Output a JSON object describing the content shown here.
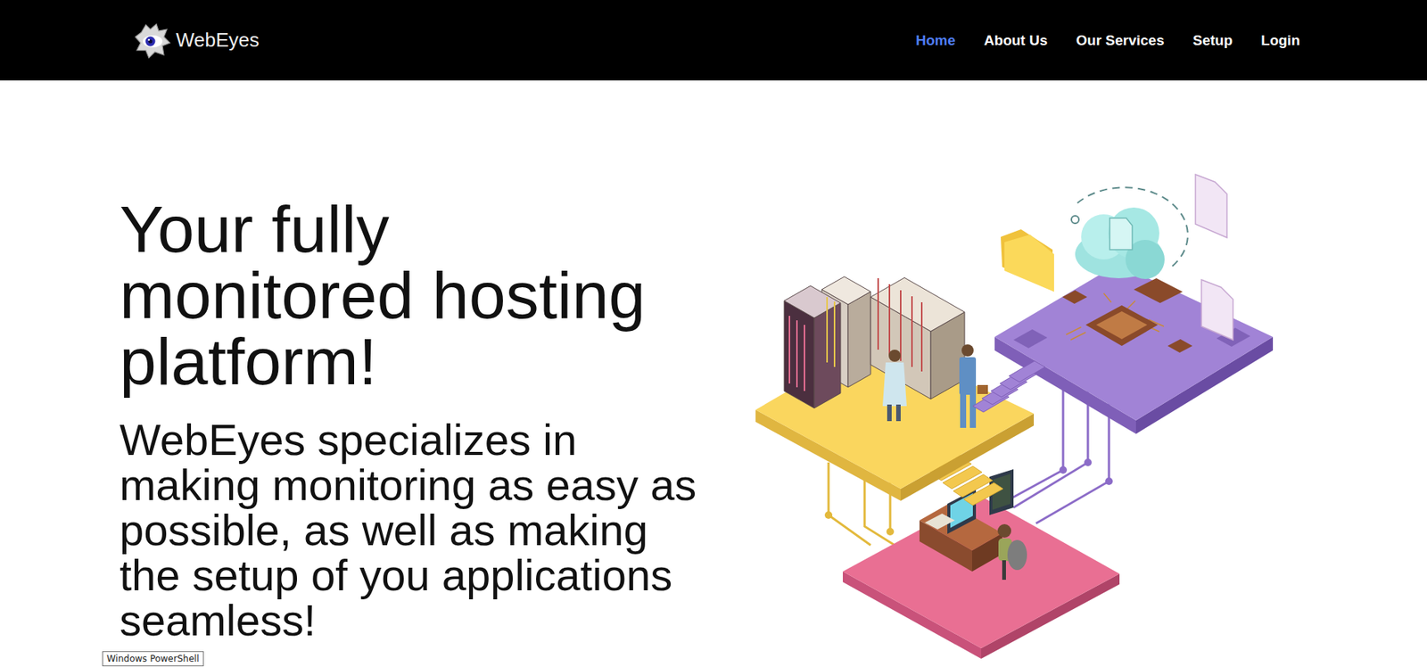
{
  "logo": {
    "text": "WebEyes"
  },
  "nav": [
    {
      "label": "Home",
      "selected": true
    },
    {
      "label": "About Us",
      "selected": false
    },
    {
      "label": "Our Services",
      "selected": false
    },
    {
      "label": "Setup",
      "selected": false
    },
    {
      "label": "Login",
      "selected": false
    }
  ],
  "hero": {
    "title_lines": [
      "Your fully",
      "monitored hosting",
      "platform!"
    ],
    "subtitle_lines": [
      "WebEyes specializes in",
      "making monitoring as easy as",
      "possible, as well as making",
      "the setup of you applications",
      "seamless!"
    ]
  },
  "tooltip": {
    "text": "Windows PowerShell"
  }
}
